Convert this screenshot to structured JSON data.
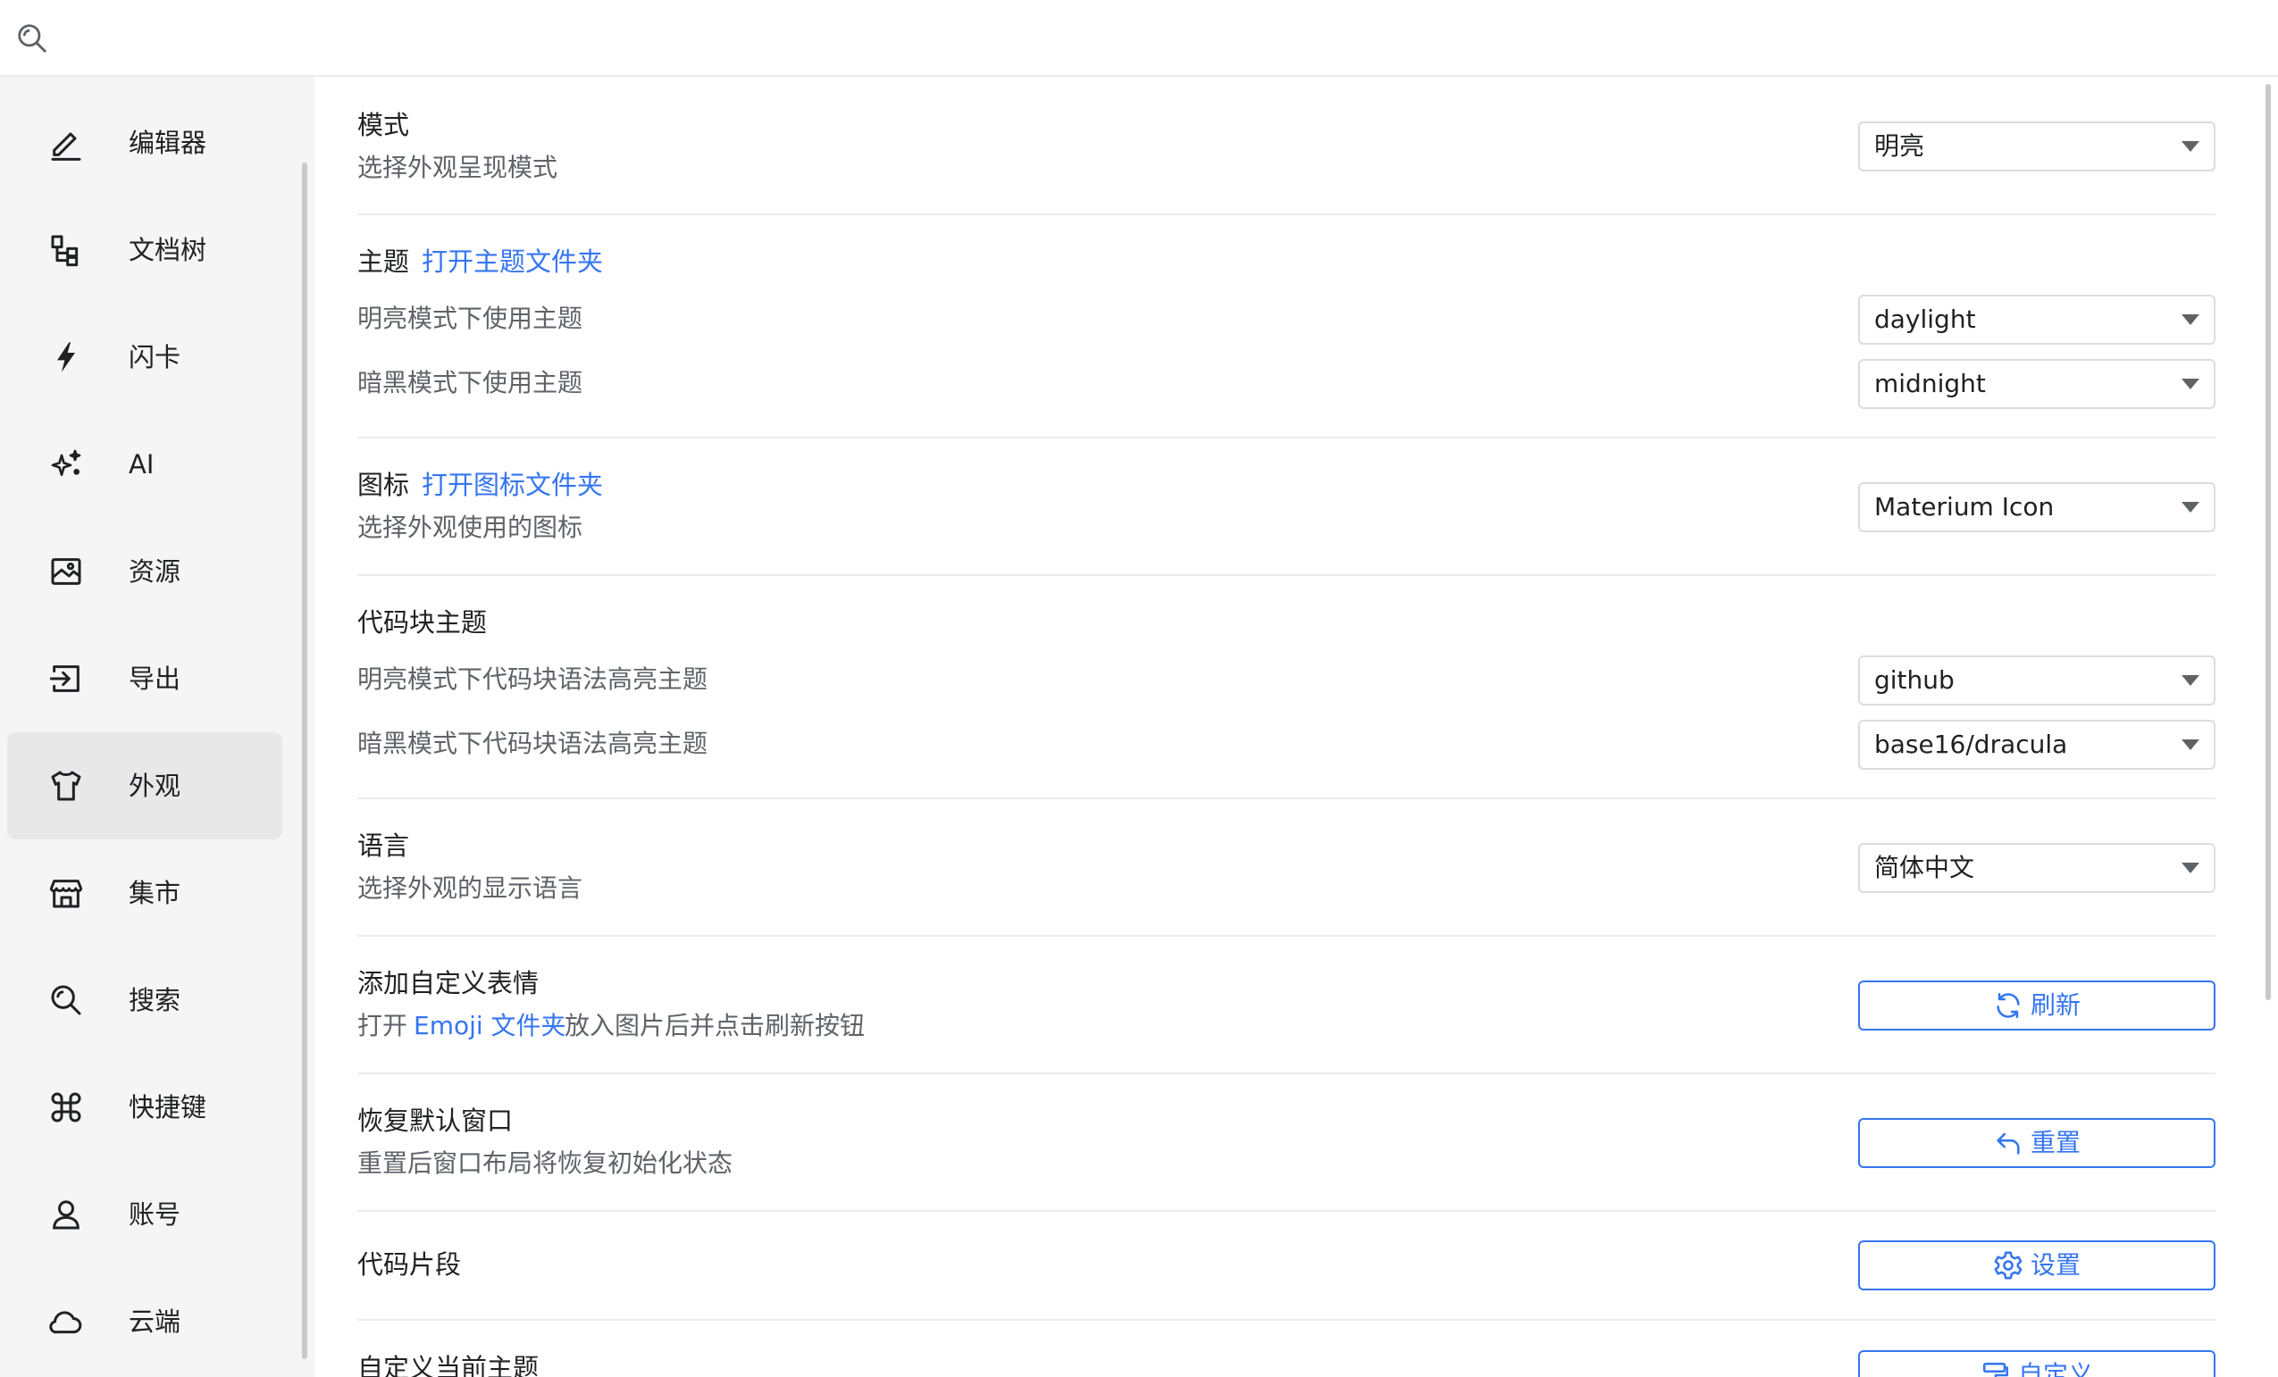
{
  "search": {
    "placeholder": "",
    "value": ""
  },
  "sidebar": {
    "items": [
      {
        "label": "编辑器",
        "icon": "pencil-icon",
        "active": false
      },
      {
        "label": "文档树",
        "icon": "file-tree-icon",
        "active": false
      },
      {
        "label": "闪卡",
        "icon": "lightning-icon",
        "active": false
      },
      {
        "label": "AI",
        "icon": "sparkles-icon",
        "active": false
      },
      {
        "label": "资源",
        "icon": "image-icon",
        "active": false
      },
      {
        "label": "导出",
        "icon": "export-icon",
        "active": false
      },
      {
        "label": "外观",
        "icon": "shirt-icon",
        "active": true
      },
      {
        "label": "集市",
        "icon": "shop-icon",
        "active": false
      },
      {
        "label": "搜索",
        "icon": "search-icon",
        "active": false
      },
      {
        "label": "快捷键",
        "icon": "command-icon",
        "active": false
      },
      {
        "label": "账号",
        "icon": "user-icon",
        "active": false
      },
      {
        "label": "云端",
        "icon": "cloud-icon",
        "active": false
      }
    ]
  },
  "settings": {
    "mode": {
      "title": "模式",
      "desc": "选择外观呈现模式",
      "value": "明亮"
    },
    "theme": {
      "title": "主题",
      "link": "打开主题文件夹",
      "light_desc": "明亮模式下使用主题",
      "light_value": "daylight",
      "dark_desc": "暗黑模式下使用主题",
      "dark_value": "midnight"
    },
    "icon": {
      "title": "图标",
      "link": "打开图标文件夹",
      "desc": "选择外观使用的图标",
      "value": "Materium Icon"
    },
    "code_theme": {
      "title": "代码块主题",
      "light_desc": "明亮模式下代码块语法高亮主题",
      "light_value": "github",
      "dark_desc": "暗黑模式下代码块语法高亮主题",
      "dark_value": "base16/dracula"
    },
    "language": {
      "title": "语言",
      "desc": "选择外观的显示语言",
      "value": "简体中文"
    },
    "emoji": {
      "title": "添加自定义表情",
      "desc_prefix": "打开",
      "desc_link": "Emoji 文件夹",
      "desc_suffix": "放入图片后并点击刷新按钮",
      "button": "刷新"
    },
    "window": {
      "title": "恢复默认窗口",
      "desc": "重置后窗口布局将恢复初始化状态",
      "button": "重置"
    },
    "snippets": {
      "title": "代码片段",
      "button": "设置"
    },
    "custom_theme": {
      "title": "自定义当前主题",
      "button": "自定义"
    }
  },
  "colors": {
    "accent": "#3575f0",
    "sidebar_bg": "#f5f5f5",
    "active_item": "#e8e8e8"
  }
}
